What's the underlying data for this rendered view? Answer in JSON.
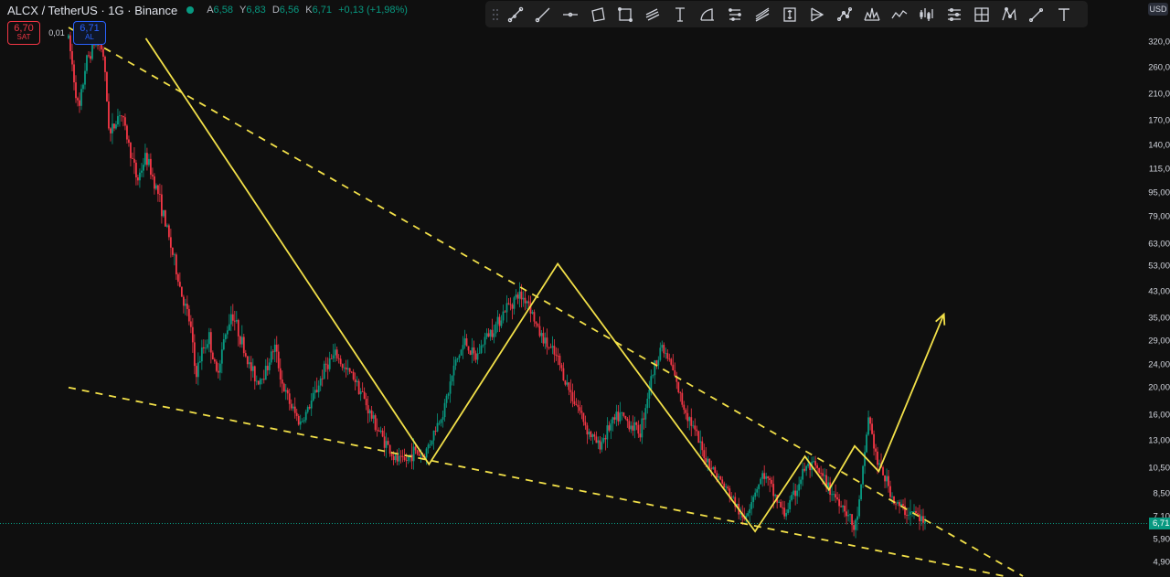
{
  "header": {
    "symbol_title": "ALCX / TetherUS · 1G · Binance",
    "ohlc": [
      {
        "key": "A",
        "value": "6,58"
      },
      {
        "key": "Y",
        "value": "6,83"
      },
      {
        "key": "D",
        "value": "6,56"
      },
      {
        "key": "K",
        "value": "6,71"
      }
    ],
    "change": "+0,13 (+1,98%)"
  },
  "trade": {
    "sell_price": "6,70",
    "sell_label": "SAT",
    "spread": "0,01",
    "buy_price": "6,71",
    "buy_label": "AL"
  },
  "toolbar": {
    "tools": [
      "trend-line-icon",
      "ray-icon",
      "horizontal-line-icon",
      "rotated-rect-icon",
      "rectangle-icon",
      "parallel-channel-icon",
      "text-cursor-icon",
      "arc-icon",
      "regression-icon",
      "fib-fan-icon",
      "long-position-icon",
      "forecast-icon",
      "network-icon",
      "head-shoulders-icon",
      "polyline-icon",
      "bars-pattern-icon",
      "projection-icon",
      "measure-grid-icon",
      "xabcd-icon",
      "brush-icon",
      "text-icon"
    ]
  },
  "price_axis": {
    "currency": "USD",
    "ticks": [
      "320,0",
      "260,0",
      "210,0",
      "170,0",
      "140,0",
      "115,0",
      "95,00",
      "79,00",
      "63,00",
      "53,00",
      "43,00",
      "35,00",
      "29,00",
      "24,00",
      "20,00",
      "16,00",
      "13,00",
      "10,50",
      "8,50",
      "7,10",
      "5,90",
      "4,90"
    ],
    "last_price": "6,71"
  },
  "colors": {
    "background": "#0f0f0f",
    "up": "#089981",
    "down": "#f23645",
    "drawing": "#f2e049",
    "buy": "#2962ff"
  },
  "chart_data": {
    "type": "candlestick",
    "yscale": "log",
    "ylim": [
      4.4,
      360
    ],
    "last_price": 6.71,
    "price_path": [
      [
        0,
        330
      ],
      [
        0.6,
        180
      ],
      [
        1.0,
        270
      ],
      [
        1.6,
        330
      ],
      [
        2.0,
        300
      ],
      [
        2.4,
        150
      ],
      [
        3.0,
        185
      ],
      [
        3.4,
        150
      ],
      [
        4.0,
        105
      ],
      [
        4.5,
        128
      ],
      [
        5.2,
        96
      ],
      [
        5.8,
        68
      ],
      [
        6.2,
        54
      ],
      [
        6.6,
        42
      ],
      [
        7.1,
        33
      ],
      [
        7.4,
        22
      ],
      [
        7.8,
        27
      ],
      [
        8.2,
        30
      ],
      [
        8.6,
        22
      ],
      [
        9.0,
        28
      ],
      [
        9.5,
        37
      ],
      [
        10.0,
        30
      ],
      [
        10.5,
        24
      ],
      [
        11.0,
        21
      ],
      [
        11.5,
        23
      ],
      [
        12.0,
        28
      ],
      [
        12.5,
        20
      ],
      [
        13.0,
        17
      ],
      [
        13.5,
        15
      ],
      [
        14.0,
        17
      ],
      [
        14.5,
        20
      ],
      [
        15.0,
        24
      ],
      [
        15.6,
        26
      ],
      [
        16.1,
        23
      ],
      [
        16.6,
        22
      ],
      [
        17.1,
        19
      ],
      [
        17.6,
        16
      ],
      [
        18.1,
        14
      ],
      [
        18.6,
        12.5
      ],
      [
        19.0,
        11.2
      ],
      [
        19.6,
        11
      ],
      [
        20.1,
        12
      ],
      [
        20.7,
        11.5
      ],
      [
        21.3,
        14
      ],
      [
        21.9,
        17
      ],
      [
        22.5,
        24
      ],
      [
        23.1,
        29
      ],
      [
        23.7,
        25
      ],
      [
        24.3,
        30
      ],
      [
        24.9,
        33
      ],
      [
        25.5,
        38
      ],
      [
        26.2,
        42
      ],
      [
        26.8,
        40
      ],
      [
        27.3,
        32
      ],
      [
        27.9,
        28
      ],
      [
        28.5,
        25
      ],
      [
        29.1,
        20
      ],
      [
        29.7,
        17
      ],
      [
        30.3,
        14
      ],
      [
        30.9,
        12.5
      ],
      [
        31.5,
        14.5
      ],
      [
        32.1,
        16
      ],
      [
        32.7,
        15
      ],
      [
        33.3,
        14
      ],
      [
        33.9,
        21
      ],
      [
        34.5,
        28
      ],
      [
        35.1,
        24
      ],
      [
        35.7,
        18
      ],
      [
        36.3,
        15
      ],
      [
        36.9,
        12
      ],
      [
        37.5,
        10.5
      ],
      [
        38.1,
        9.2
      ],
      [
        38.7,
        8.2
      ],
      [
        39.3,
        6.8
      ],
      [
        39.9,
        8.5
      ],
      [
        40.5,
        10
      ],
      [
        41.1,
        8.5
      ],
      [
        41.7,
        7.2
      ],
      [
        42.3,
        8.5
      ],
      [
        42.9,
        10.5
      ],
      [
        43.5,
        10.5
      ],
      [
        44.1,
        9.3
      ],
      [
        44.7,
        8.3
      ],
      [
        45.3,
        7.5
      ],
      [
        45.8,
        6.3
      ],
      [
        46.2,
        9
      ],
      [
        46.6,
        16
      ],
      [
        47.1,
        11
      ],
      [
        47.6,
        9.6
      ],
      [
        48.1,
        8
      ],
      [
        48.7,
        7.4
      ],
      [
        49.3,
        7.3
      ],
      [
        49.9,
        6.7
      ]
    ],
    "drawings": {
      "descending_resistance": [
        [
          0.0,
          360
        ],
        [
          55.6,
          4.4
        ]
      ],
      "descending_support": [
        [
          0.0,
          20
        ],
        [
          54.5,
          4.4
        ]
      ],
      "zigzag": [
        [
          4.5,
          330
        ],
        [
          21.0,
          10.8
        ],
        [
          28.5,
          54
        ],
        [
          40.0,
          6.3
        ],
        [
          42.9,
          11.5
        ],
        [
          44.3,
          8.8
        ],
        [
          45.8,
          12.5
        ],
        [
          47.2,
          10.2
        ],
        [
          51.0,
          36
        ]
      ]
    }
  }
}
